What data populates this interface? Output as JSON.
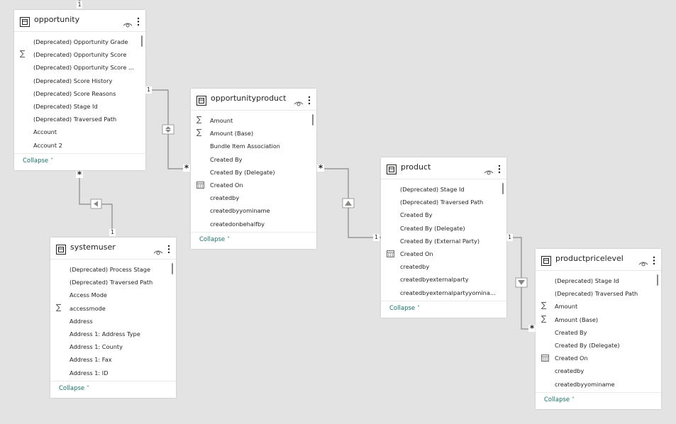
{
  "tables": {
    "opportunity": {
      "title": "opportunity",
      "collapse_label": "Collapse",
      "fields": [
        {
          "label": "(Deprecated) Opportunity Grade",
          "icon": ""
        },
        {
          "label": "(Deprecated) Opportunity Score",
          "icon": "sigma-icon"
        },
        {
          "label": "(Deprecated) Opportunity Score ...",
          "icon": ""
        },
        {
          "label": "(Deprecated) Score History",
          "icon": ""
        },
        {
          "label": "(Deprecated) Score Reasons",
          "icon": ""
        },
        {
          "label": "(Deprecated) Stage Id",
          "icon": ""
        },
        {
          "label": "(Deprecated) Traversed Path",
          "icon": ""
        },
        {
          "label": "Account",
          "icon": ""
        },
        {
          "label": "Account 2",
          "icon": ""
        }
      ]
    },
    "opportunityproduct": {
      "title": "opportunityproduct",
      "collapse_label": "Collapse",
      "fields": [
        {
          "label": "Amount",
          "icon": "sigma-icon"
        },
        {
          "label": "Amount (Base)",
          "icon": "sigma-icon"
        },
        {
          "label": "Bundle Item Association",
          "icon": ""
        },
        {
          "label": "Created By",
          "icon": ""
        },
        {
          "label": "Created By (Delegate)",
          "icon": ""
        },
        {
          "label": "Created On",
          "icon": "calendar-icon"
        },
        {
          "label": "createdby",
          "icon": ""
        },
        {
          "label": "createdbyyominame",
          "icon": ""
        },
        {
          "label": "createdonbehalfby",
          "icon": ""
        }
      ]
    },
    "systemuser": {
      "title": "systemuser",
      "collapse_label": "Collapse",
      "fields": [
        {
          "label": "(Deprecated) Process Stage",
          "icon": ""
        },
        {
          "label": "(Deprecated) Traversed Path",
          "icon": ""
        },
        {
          "label": "Access Mode",
          "icon": ""
        },
        {
          "label": "accessmode",
          "icon": "sigma-icon"
        },
        {
          "label": "Address",
          "icon": ""
        },
        {
          "label": "Address 1: Address Type",
          "icon": ""
        },
        {
          "label": "Address 1: County",
          "icon": ""
        },
        {
          "label": "Address 1: Fax",
          "icon": ""
        },
        {
          "label": "Address 1: ID",
          "icon": ""
        }
      ]
    },
    "product": {
      "title": "product",
      "collapse_label": "Collapse",
      "fields": [
        {
          "label": "(Deprecated) Stage Id",
          "icon": ""
        },
        {
          "label": "(Deprecated) Traversed Path",
          "icon": ""
        },
        {
          "label": "Created By",
          "icon": ""
        },
        {
          "label": "Created By (Delegate)",
          "icon": ""
        },
        {
          "label": "Created By (External Party)",
          "icon": ""
        },
        {
          "label": "Created On",
          "icon": "calendar-icon"
        },
        {
          "label": "createdby",
          "icon": ""
        },
        {
          "label": "createdbyexternalparty",
          "icon": ""
        },
        {
          "label": "createdbyexternalpartyyomina...",
          "icon": ""
        }
      ]
    },
    "productpricelevel": {
      "title": "productpricelevel",
      "collapse_label": "Collapse",
      "fields": [
        {
          "label": "(Deprecated) Stage Id",
          "icon": ""
        },
        {
          "label": "(Deprecated) Traversed Path",
          "icon": ""
        },
        {
          "label": "Amount",
          "icon": "sigma-icon"
        },
        {
          "label": "Amount (Base)",
          "icon": "sigma-icon"
        },
        {
          "label": "Created By",
          "icon": ""
        },
        {
          "label": "Created By (Delegate)",
          "icon": ""
        },
        {
          "label": "Created On",
          "icon": "calendar-icon"
        },
        {
          "label": "createdby",
          "icon": ""
        },
        {
          "label": "createdbyyominame",
          "icon": ""
        }
      ]
    }
  },
  "cardinality": {
    "one": "1",
    "many": "*"
  },
  "colors": {
    "line": "#8a8886",
    "accent": "#1b6e67",
    "canvas": "#e3e3e3"
  }
}
